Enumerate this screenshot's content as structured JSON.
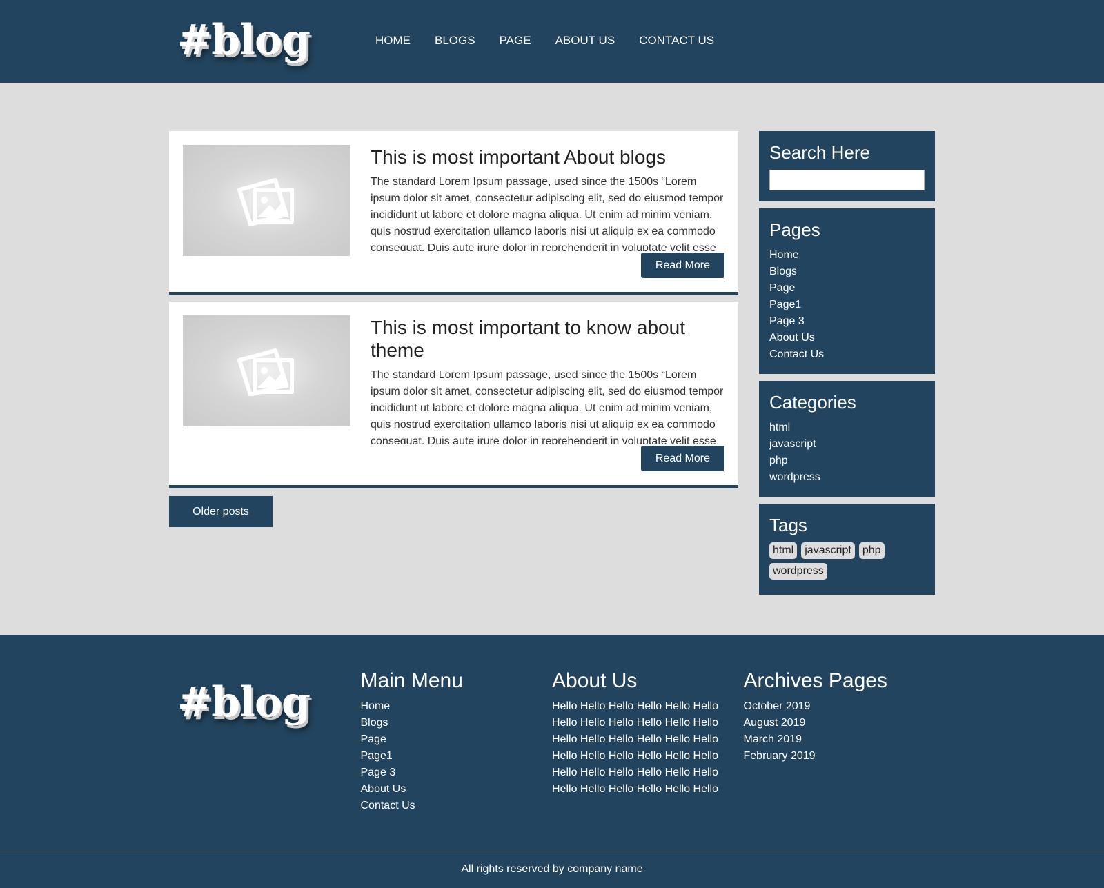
{
  "brand": {
    "logo_text": "#blog"
  },
  "nav": {
    "items": [
      "HOME",
      "BLOGS",
      "PAGE",
      "ABOUT US",
      "CONTACT US"
    ]
  },
  "posts": [
    {
      "title": "This is most important About blogs",
      "excerpt": "The standard Lorem Ipsum passage, used since the 1500s “Lorem ipsum dolor sit amet, consectetur adipiscing elit, sed do eiusmod tempor incididunt ut labore et dolore magna aliqua. Ut enim ad minim veniam, quis nostrud exercitation ullamco laboris nisi ut aliquip ex ea commodo consequat. Duis aute irure dolor in reprehenderit in voluptate velit esse",
      "read_more": "Read More"
    },
    {
      "title": "This is most important to know about theme",
      "excerpt": "The standard Lorem Ipsum passage, used since the 1500s “Lorem ipsum dolor sit amet, consectetur adipiscing elit, sed do eiusmod tempor incididunt ut labore et dolore magna aliqua. Ut enim ad minim veniam, quis nostrud exercitation ullamco laboris nisi ut aliquip ex ea commodo consequat. Duis aute irure dolor in reprehenderit in voluptate velit esse",
      "read_more": "Read More"
    }
  ],
  "pagination": {
    "older_label": "Older posts"
  },
  "sidebar": {
    "search": {
      "title": "Search Here",
      "value": ""
    },
    "pages": {
      "title": "Pages",
      "items": [
        "Home",
        "Blogs",
        "Page",
        "Page1",
        "Page 3",
        "About Us",
        "Contact Us"
      ]
    },
    "categories": {
      "title": "Categories",
      "items": [
        "html",
        "javascript",
        "php",
        "wordpress"
      ]
    },
    "tags": {
      "title": "Tags",
      "items": [
        "html",
        "javascript",
        "php",
        "wordpress"
      ]
    }
  },
  "footer": {
    "logo_text": "#blog",
    "main_menu": {
      "title": "Main Menu",
      "items": [
        "Home",
        "Blogs",
        "Page",
        "Page1",
        "Page 3",
        "About Us",
        "Contact Us"
      ]
    },
    "about": {
      "title": "About Us",
      "text": "Hello Hello Hello Hello Hello Hello Hello Hello Hello Hello Hello Hello Hello Hello Hello Hello Hello Hello Hello Hello Hello Hello Hello Hello Hello Hello Hello Hello Hello Hello Hello Hello Hello Hello Hello Hello"
    },
    "archives": {
      "title": "Archives Pages",
      "items": [
        "October 2019",
        "August 2019",
        "March 2019",
        "February 2019"
      ]
    },
    "copyright": "All rights reserved by company name"
  },
  "colors": {
    "primary": "#22445e",
    "background": "#dddddd",
    "card": "#ffffff",
    "tag_bg": "#dddddd"
  },
  "icons": {
    "post_thumbnail": "image-placeholder-icon"
  }
}
